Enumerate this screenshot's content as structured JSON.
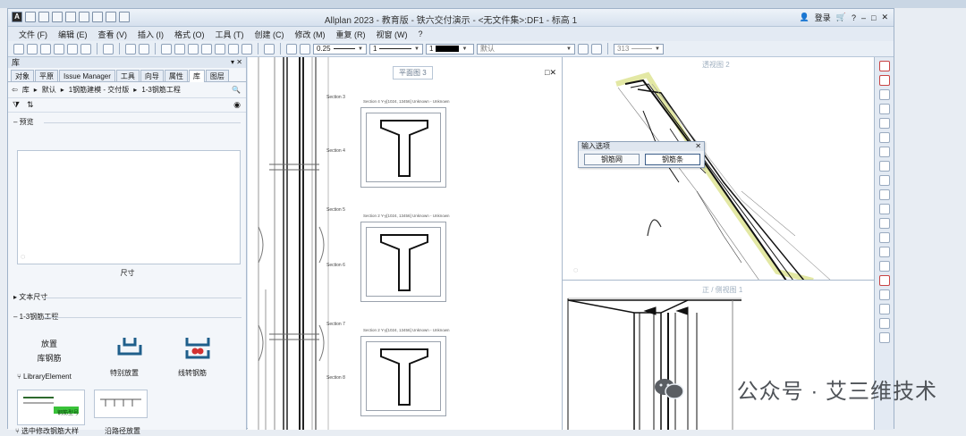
{
  "window": {
    "title": "Allplan 2023 - 教育版 - 铁六交付演示 - <无文件集>:DF1 - 标高 1",
    "login": "登录"
  },
  "menu": [
    "文件 (F)",
    "编辑 (E)",
    "查看 (V)",
    "插入 (I)",
    "格式 (O)",
    "工具 (T)",
    "创建 (C)",
    "修改 (M)",
    "重复 (R)",
    "视窗 (W)",
    "?"
  ],
  "toolbar": {
    "pen_thickness": "0.25",
    "line_type": "1",
    "color_index": "1",
    "layer": "默认",
    "scale": "313"
  },
  "library": {
    "header": "库",
    "tabs": [
      "对象",
      "平原",
      "Issue Manager",
      "工具",
      "向导",
      "属性",
      "库",
      "图层"
    ],
    "active_tab": "库",
    "breadcrumb": [
      "库",
      "默认",
      "1钢筋建模 - 交付版",
      "1-3钢筋工程"
    ],
    "preview_section": "预览",
    "preview_size_label": "尺寸",
    "text_size_section": "文本尺寸",
    "group_section": "1-3钢筋工程",
    "items": [
      {
        "label_line1": "放置",
        "label_line2": "库钢筋",
        "caption": "LibraryElement"
      },
      {
        "caption": "特别放置"
      },
      {
        "caption": "线转钢筋"
      },
      {
        "caption": "选中修改钢筋大样",
        "tag": "钢筋型号"
      },
      {
        "caption": "沿路径放置"
      }
    ]
  },
  "views": {
    "plan3": "平面图 3",
    "iso2": "透视图 2",
    "front1": "正 / 侧视图 1"
  },
  "drawing": {
    "sections": [
      "Section 3",
      "Section 4",
      "Section 5",
      "Section 6",
      "Section 7",
      "Section 8"
    ],
    "sheet_captions": [
      "Section 4 Y-y[1024, 13456] Unknown - Unknown",
      "Section 2 Y-y[1024, 13456] Unknown - Unknown",
      "Section 2 Y-y[1024, 13456] Unknown - Unknown"
    ]
  },
  "dialog": {
    "title": "输入选项",
    "buttons": [
      "钢筋网",
      "钢筋条"
    ],
    "selected": "钢筋条"
  },
  "watermark": "公众号 · 艾三维技术"
}
